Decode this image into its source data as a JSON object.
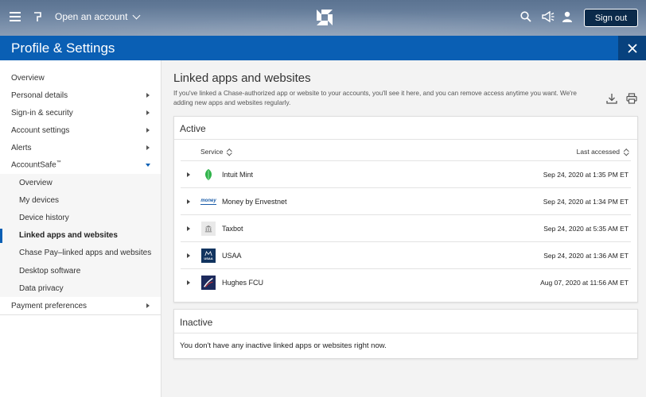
{
  "topbar": {
    "open_account": "Open an account",
    "sign_out": "Sign out"
  },
  "header": {
    "title": "Profile & Settings"
  },
  "sidebar": {
    "items": [
      {
        "label": "Overview",
        "arrow": "none"
      },
      {
        "label": "Personal details",
        "arrow": "right"
      },
      {
        "label": "Sign-in & security",
        "arrow": "right"
      },
      {
        "label": "Account settings",
        "arrow": "right"
      },
      {
        "label": "Alerts",
        "arrow": "right"
      }
    ],
    "accountsafe": {
      "label": "AccountSafe",
      "tm": "™",
      "sub_items": [
        "Overview",
        "My devices",
        "Device history",
        "Linked apps and websites",
        "Chase Pay–linked apps and websites",
        "Desktop software",
        "Data privacy"
      ]
    },
    "payment": "Payment preferences"
  },
  "main": {
    "title": "Linked apps and websites",
    "intro": "If you've linked a Chase-authorized app or website to your accounts, you'll see it here, and you can remove access anytime you want. We're adding new apps and websites regularly.",
    "active": {
      "title": "Active",
      "col_service": "Service",
      "col_last": "Last accessed",
      "rows": [
        {
          "service": "Intuit Mint",
          "date": "Sep 24, 2020 at 1:35 PM ET",
          "icon": "mint-leaf-icon"
        },
        {
          "service": "Money by Envestnet",
          "date": "Sep 24, 2020 at 1:34 PM ET",
          "icon": "money-logo-icon",
          "logo_text": "money"
        },
        {
          "service": "Taxbot",
          "date": "Sep 24, 2020 at 5:35 AM ET",
          "icon": "bank-icon"
        },
        {
          "service": "USAA",
          "date": "Sep 24, 2020 at 1:36 AM ET",
          "icon": "usaa-logo-icon",
          "logo_text": "USAA"
        },
        {
          "service": "Hughes FCU",
          "date": "Aug 07, 2020 at 11:56 AM ET",
          "icon": "hughes-logo-icon"
        }
      ]
    },
    "inactive": {
      "title": "Inactive",
      "message": "You don't have any inactive linked apps or websites right now."
    }
  },
  "colors": {
    "brand_blue": "#0a5fb4",
    "dark_blue": "#08427e",
    "sign_out_bg": "#0b2a4a"
  }
}
